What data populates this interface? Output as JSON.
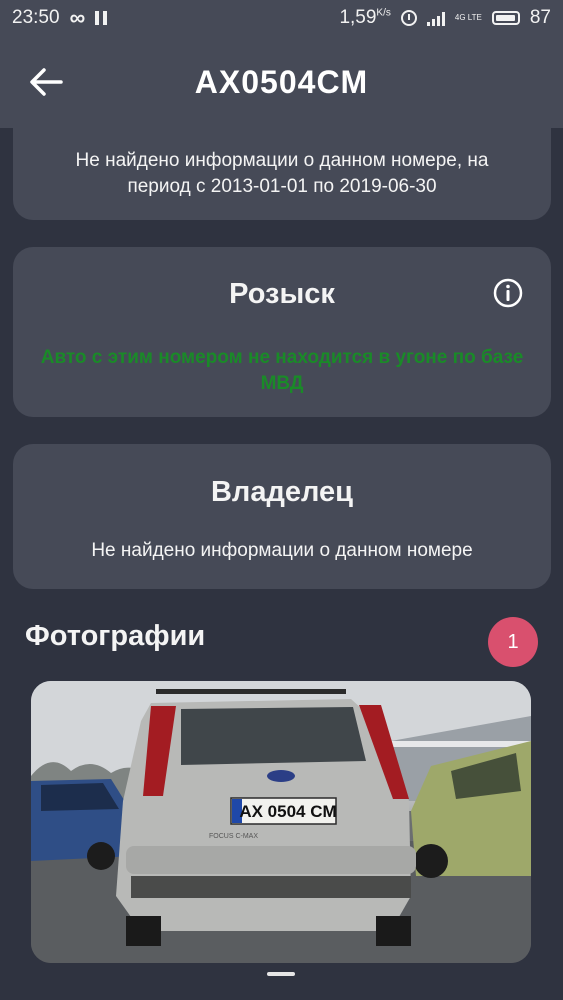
{
  "status_bar": {
    "time": "23:50",
    "speed": "1,59",
    "speed_unit": "K/s",
    "battery": "87",
    "network": "4G LTE"
  },
  "header": {
    "title": "AX0504CM"
  },
  "cards": {
    "period_info": "Не найдено информации о данном номере, на период с 2013-01-01 по 2019-06-30",
    "wanted": {
      "title": "Розыск",
      "status": "Авто с этим номером не находится в угоне по базе МВД"
    },
    "owner": {
      "title": "Владелец",
      "text": "Не найдено информации о данном номере"
    }
  },
  "photos": {
    "heading": "Фотографии",
    "count": "1",
    "plate": "AX 0504 CM",
    "car_badge": "FOCUS C-MAX"
  },
  "colors": {
    "background": "#2f3340",
    "card": "#464a57",
    "ok_status": "#1a8a28",
    "badge": "#d9506e"
  }
}
